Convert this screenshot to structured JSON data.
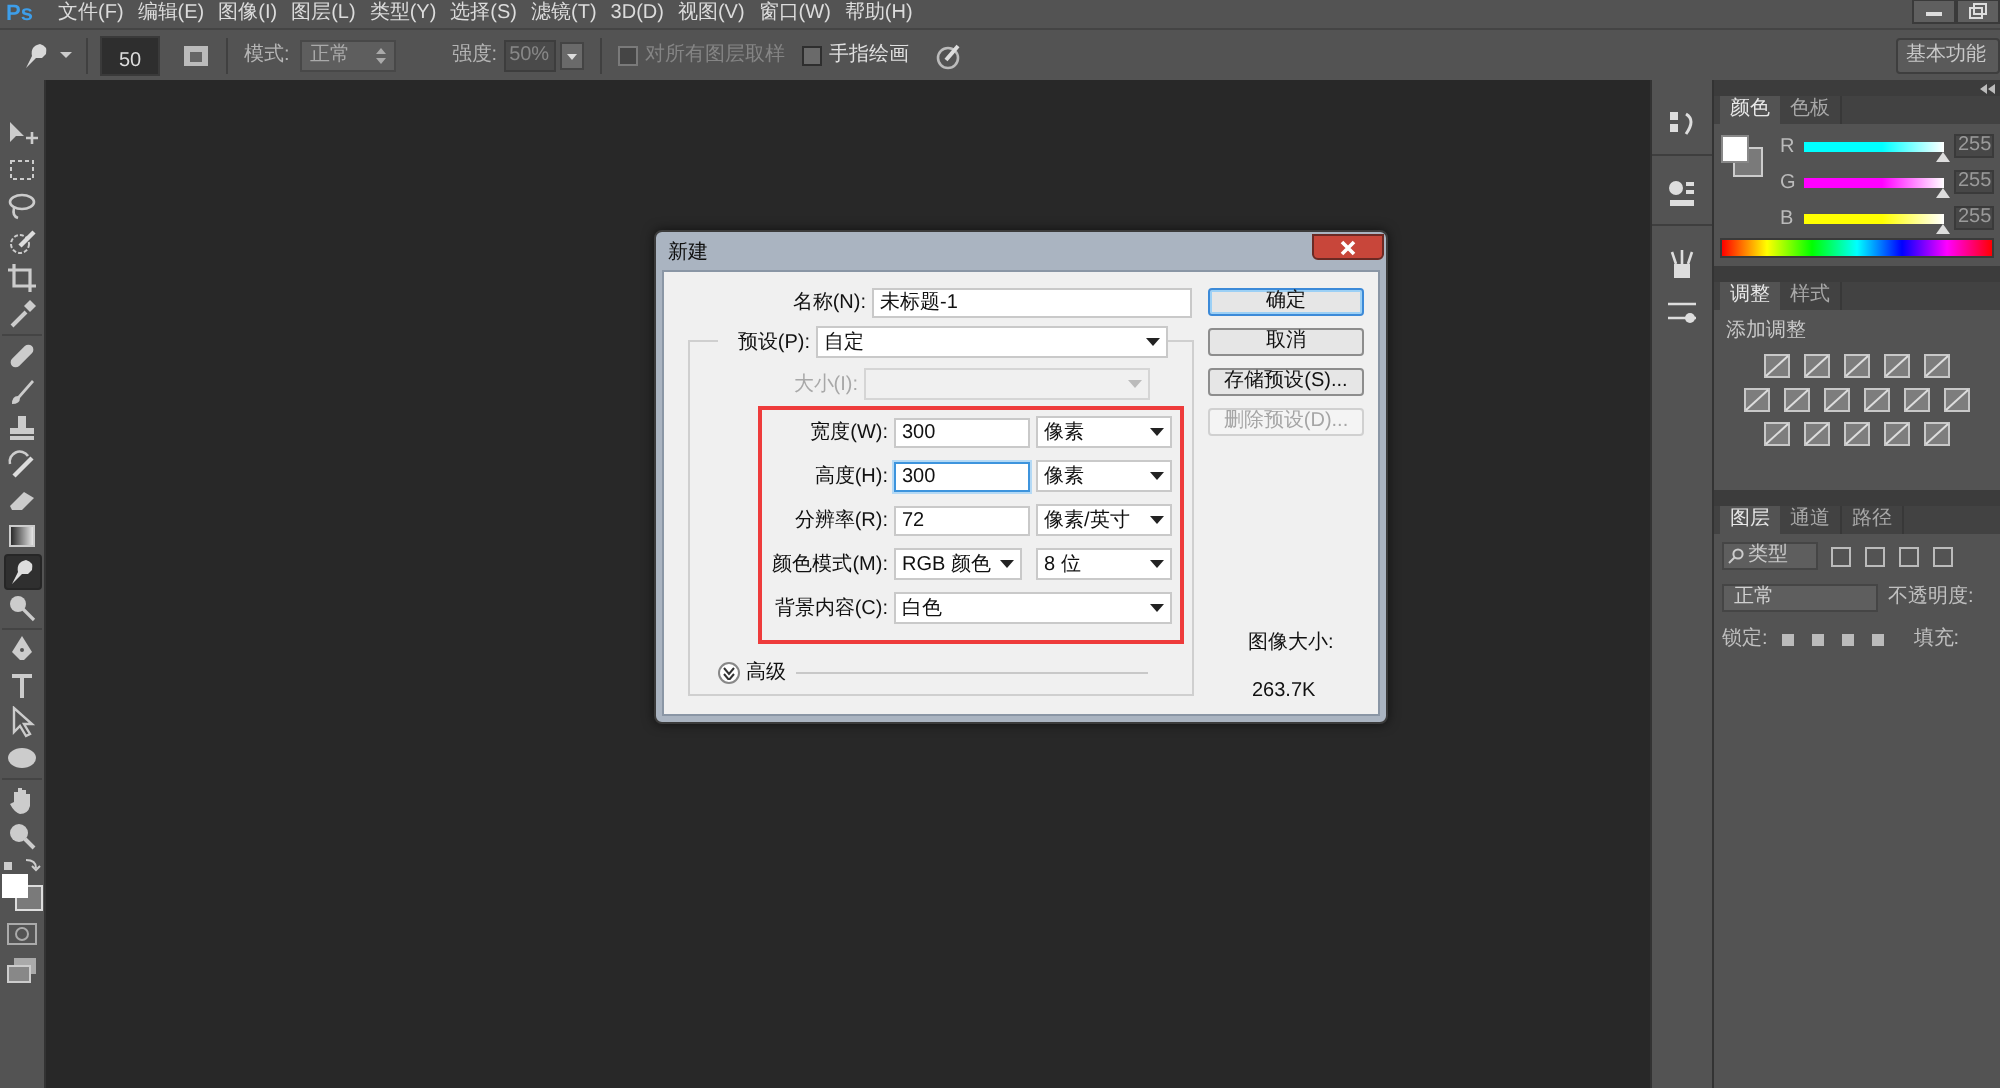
{
  "app": {
    "logo": "Ps"
  },
  "menu": [
    "文件(F)",
    "编辑(E)",
    "图像(I)",
    "图层(L)",
    "类型(Y)",
    "选择(S)",
    "滤镜(T)",
    "3D(D)",
    "视图(V)",
    "窗口(W)",
    "帮助(H)"
  ],
  "options_bar": {
    "brush_size": "50",
    "mode_label": "模式:",
    "mode": "正常",
    "strength_label": "强度:",
    "strength": "50%",
    "checks": [
      {
        "label": "对所有图层取样",
        "checked": false,
        "disabled": true
      },
      {
        "label": "手指绘画",
        "checked": false,
        "disabled": false
      }
    ],
    "workspace": "基本功能"
  },
  "tools": [
    {
      "selected": false
    },
    {
      "selected": false
    },
    {
      "selected": false
    },
    {
      "selected": false
    },
    {
      "selected": false
    },
    {
      "selected": false
    },
    {
      "selected": false
    },
    {
      "selected": false
    },
    {
      "selected": false
    },
    {
      "selected": false
    },
    {
      "selected": false
    },
    {
      "selected": false
    },
    {
      "selected": true
    },
    {
      "selected": false
    },
    {
      "selected": false
    },
    {
      "selected": false
    },
    {
      "selected": false
    },
    {
      "selected": false
    },
    {
      "selected": false
    },
    {
      "selected": false
    }
  ],
  "dialog": {
    "title": "新建",
    "name": {
      "label": "名称(N):",
      "value": "未标题-1"
    },
    "preset": {
      "label": "预设(P):",
      "value": "自定"
    },
    "size": {
      "label": "大小(I):",
      "disabled": true
    },
    "rows": [
      {
        "kind": "field",
        "label": "宽度(W):",
        "value": "300",
        "unit": "像素",
        "focused": false
      },
      {
        "kind": "field",
        "label": "高度(H):",
        "value": "300",
        "unit": "像素",
        "focused": true
      },
      {
        "kind": "field",
        "label": "分辨率(R):",
        "value": "72",
        "unit": "像素/英寸",
        "focused": false
      },
      {
        "kind": "select",
        "label": "颜色模式(M):",
        "value": "RGB 颜色",
        "unit": "8 位"
      },
      {
        "kind": "wide",
        "label": "背景内容(C):",
        "value": "白色"
      }
    ],
    "advanced": {
      "label": "高级",
      "expanded": false
    },
    "buttons": [
      {
        "label": "确定",
        "default": true,
        "disabled": false
      },
      {
        "label": "取消",
        "default": false,
        "disabled": false
      },
      {
        "label": "存储预设(S)...",
        "default": false,
        "disabled": false
      },
      {
        "label": "删除预设(D)...",
        "default": false,
        "disabled": true
      }
    ],
    "image_size": {
      "label": "图像大小:",
      "value": "263.7K"
    }
  },
  "color_panel": {
    "tabs": [
      {
        "label": "颜色",
        "selected": true
      },
      {
        "label": "色板",
        "selected": false
      }
    ],
    "channels": [
      {
        "name": "R",
        "color": "#00ffff",
        "level": 1,
        "reading": "255"
      },
      {
        "name": "G",
        "color": "#ff00ff",
        "level": 1,
        "reading": "255"
      },
      {
        "name": "B",
        "color": "#ffff00",
        "level": 1,
        "reading": "255"
      }
    ]
  },
  "adjustments_panel": {
    "tabs": [
      {
        "label": "调整",
        "selected": true
      },
      {
        "label": "样式",
        "selected": false
      }
    ],
    "heading": "添加调整"
  },
  "layers_panel": {
    "tabs": [
      {
        "label": "图层",
        "selected": true
      },
      {
        "label": "通道",
        "selected": false
      },
      {
        "label": "路径",
        "selected": false
      }
    ],
    "filter": "类型",
    "blend_mode": "正常",
    "opacity_label": "不透明度:",
    "lock_label": "锁定:",
    "fill_label": "填充:"
  }
}
